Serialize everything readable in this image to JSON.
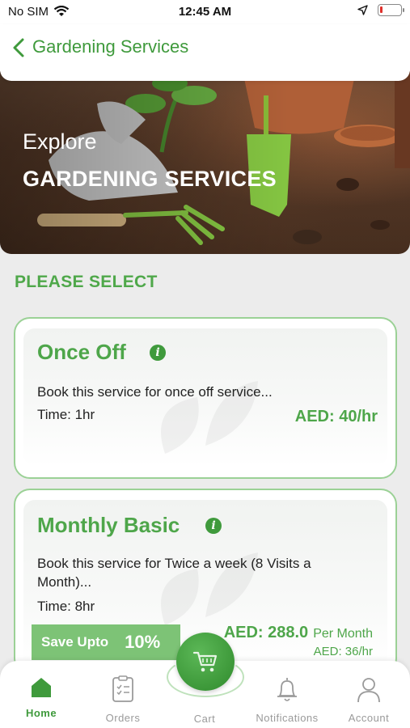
{
  "status_bar": {
    "carrier": "No SIM",
    "time": "12:45 AM"
  },
  "header": {
    "title": "Gardening Services"
  },
  "banner": {
    "line1": "Explore",
    "line2": "GARDENING SERVICES"
  },
  "section": {
    "title": "PLEASE SELECT"
  },
  "cards": [
    {
      "title": "Once Off",
      "description": "Book this service for once off service...",
      "time": "Time: 1hr",
      "price": "AED: 40/hr"
    },
    {
      "title": "Monthly Basic",
      "description": "Book this service for Twice a week (8 Visits a Month)...",
      "time": "Time: 8hr",
      "save_label": "Save Upto",
      "save_value": "10%",
      "price": "AED: 288.0",
      "price_unit": "Per Month",
      "price_sub": "AED: 36/hr"
    }
  ],
  "nav": {
    "items": [
      {
        "label": "Home"
      },
      {
        "label": "Orders"
      },
      {
        "label": "Cart"
      },
      {
        "label": "Notifications"
      },
      {
        "label": "Account"
      }
    ]
  },
  "colors": {
    "brand_green": "#3f9a3c",
    "card_border": "#9bd196",
    "badge_green": "#7dc376"
  }
}
